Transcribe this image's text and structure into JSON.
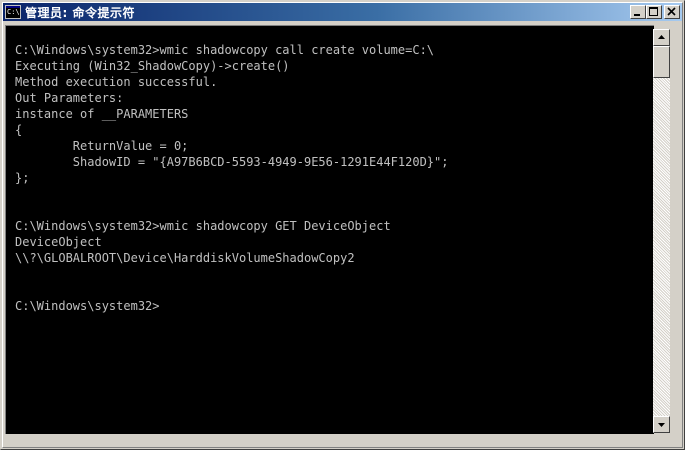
{
  "window": {
    "title": "管理员: 命令提示符",
    "icon": "cmd-console-icon",
    "icon_text": "C:\\",
    "controls": [
      "minimize-icon",
      "maximize-icon",
      "close-icon"
    ]
  },
  "console": {
    "text_color": "#c0c0c0",
    "background": "#000000",
    "lines": [
      "",
      "C:\\Windows\\system32>wmic shadowcopy call create volume=C:\\",
      "Executing (Win32_ShadowCopy)->create()",
      "Method execution successful.",
      "Out Parameters:",
      "instance of __PARAMETERS",
      "{",
      "        ReturnValue = 0;",
      "        ShadowID = \"{A97B6BCD-5593-4949-9E56-1291E44F120D}\";",
      "};",
      "",
      "",
      "C:\\Windows\\system32>wmic shadowcopy GET DeviceObject",
      "DeviceObject",
      "\\\\?\\GLOBALROOT\\Device\\HarddiskVolumeShadowCopy2",
      "",
      "",
      "C:\\Windows\\system32>"
    ]
  },
  "colors": {
    "titlebar_start": "#0a246a",
    "titlebar_end": "#a6caf0",
    "chrome": "#d4d0c8"
  }
}
